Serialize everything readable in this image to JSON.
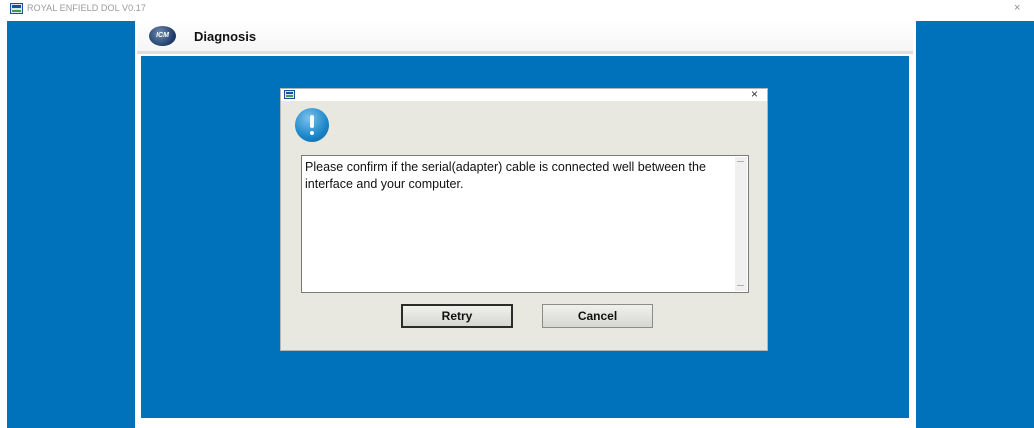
{
  "window": {
    "title": "ROYAL ENFIELD DOL V0.17",
    "close_glyph": "×"
  },
  "header": {
    "logo_text": "ICM",
    "title": "Diagnosis"
  },
  "dialog": {
    "close_glyph": "×",
    "icon": "info-exclamation-icon",
    "message": "Please confirm if the serial(adapter) cable is connected well between the interface and your computer.",
    "buttons": {
      "retry": "Retry",
      "cancel": "Cancel"
    }
  },
  "colors": {
    "panel_blue": "#0071bb",
    "dialog_bg": "#e8e8e0"
  }
}
